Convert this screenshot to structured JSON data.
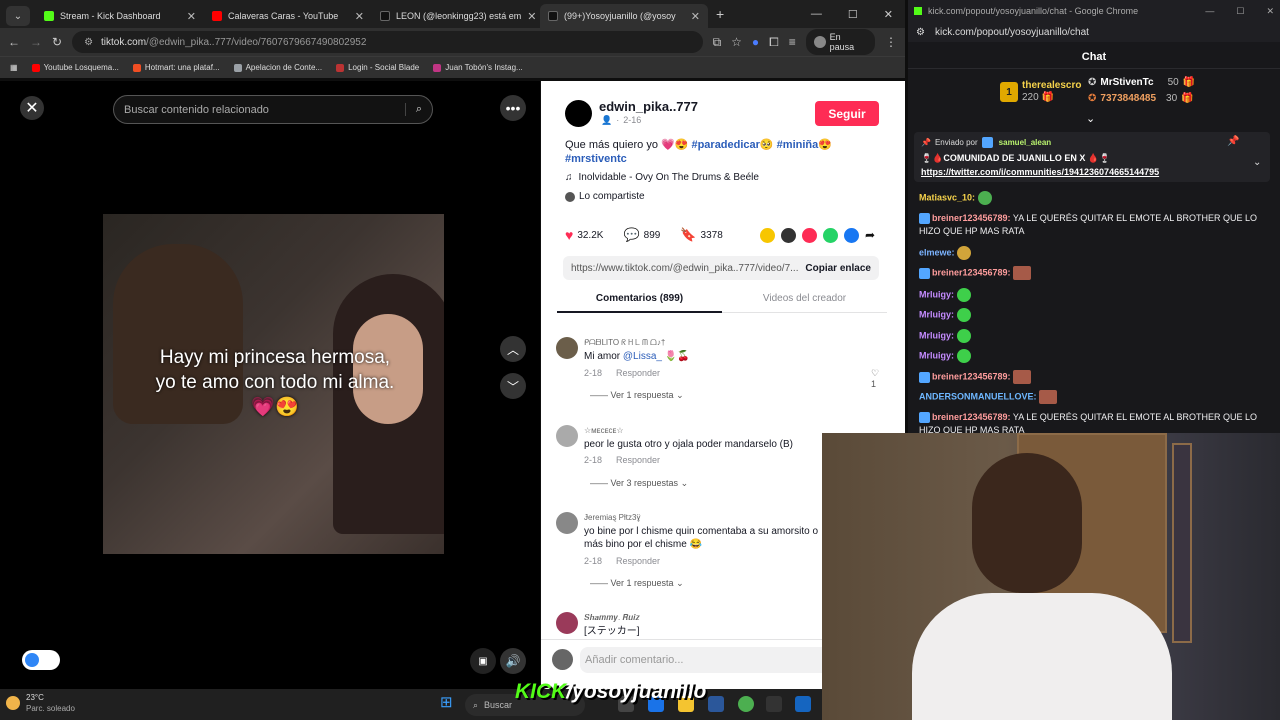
{
  "browser": {
    "tabs": [
      {
        "label": "Stream - Kick Dashboard",
        "color": "#53fc18"
      },
      {
        "label": "Calaveras Caras - YouTube",
        "color": "#ff0000"
      },
      {
        "label": "LEON (@leonkingg23) está em",
        "color": "#111111"
      },
      {
        "label": "(99+)Yosoyjuanillo (@yosoy",
        "color": "#111111",
        "active": true
      }
    ],
    "url_prefix": "tiktok.com",
    "url_rest": "/@edwin_pika..777/video/7607679667490802952",
    "paused_label": "En pausa",
    "bookmarks": [
      {
        "label": "Youtube Losquema...",
        "color": "#ff0000"
      },
      {
        "label": "Hotmart: una plataf...",
        "color": "#f04e23"
      },
      {
        "label": "Apelacion de Conte...",
        "color": "#9aa0a6"
      },
      {
        "label": "Login - Social Blade",
        "color": "#b33"
      },
      {
        "label": "Juan Tobón's Instag...",
        "color": "#c13584"
      }
    ]
  },
  "video": {
    "search_placeholder": "Buscar contenido relacionado",
    "caption": "Hayy mi princesa hermosa, yo te amo con todo mi alma.💗😍",
    "close_glyph": "✕",
    "more_glyph": "•••"
  },
  "detail": {
    "username": "edwin_pika..777",
    "follow_label": "Seguir",
    "date": "2-16",
    "desc_text": "Que más quiero yo 💗😍 ",
    "desc_tags": "#paradedicar🥺 #miniña😍 #mrstiventc",
    "music": "Inolvidable - Ovy On The Drums & Beéle",
    "shared": "Lo compartiste",
    "likes": "32.2K",
    "comments": "899",
    "saves": "3378",
    "link": "https://www.tiktok.com/@edwin_pika..777/video/7...",
    "copy_label": "Copiar enlace",
    "tab_comments": "Comentarios (899)",
    "tab_videos": "Videos del creador",
    "reply_label": "Responder",
    "comments_list": [
      {
        "name": "ᑭᗩᗷᒪITO ᖇ ᕼ ᒪ ᗰ ᗝ♪†",
        "text": "Mi amor ",
        "mention": "@Lissa_",
        "suffix": " 🌷🍒",
        "date": "2-18",
        "likes": "1",
        "replies": "Ver 1 respuesta"
      },
      {
        "name": "☆ᴍᴇᴄᴇᴄᴇ☆",
        "text": "peor le gusta otro y ojala poder mandarselo (B)",
        "date": "2-18",
        "replies": "Ver 3 respuestas"
      },
      {
        "name": "Ɉeremiaȿ Pƚtz3ɣ̈",
        "text": "yo bine por l chisme quin comentaba a su amorsito o más bino por el chisme 😂",
        "date": "2-18",
        "replies": "Ver 1 respuesta"
      },
      {
        "name": "𝑺𝒉𝒂𝒎𝒎𝒚. 𝑹𝒖𝒊𝒛",
        "text": "[ステッカー]",
        "date": "",
        "replies": ""
      }
    ],
    "add_comment_placeholder": "Añadir comentario..."
  },
  "chat": {
    "window_title": "kick.com/popout/yosoyjuanillo/chat - Google Chrome",
    "url": "kick.com/popout/yosoyjuanillo/chat",
    "header": "Chat",
    "top_rank_name": "therealescro",
    "top_rank_value": "220",
    "rank2_name": "MrStivenTc",
    "rank2_value": "50",
    "rank3_name": "7373848485",
    "rank3_value": "30",
    "pinned_by_label": "Enviado por",
    "pinned_user": "samuel_alean",
    "pinned_title": "🍷🩸COMUNIDAD DE JUANILLO EN X 🩸🍷",
    "pinned_link": "https://twitter.com/i/communities/1941236074665144795",
    "messages": [
      {
        "user": "Matiasvc_10:",
        "color": "#f5d24b",
        "text": ""
      },
      {
        "user": "breiner123456789:",
        "color": "#ff9d9d",
        "text": " YA LE QUERÉS QUITAR EL EMOTE AL BROTHER QUE LO HIZO QUE HP MAS RATA",
        "badge": true
      },
      {
        "user": "elmewe:",
        "color": "#7bb3ff",
        "text": ""
      },
      {
        "user": "breiner123456789:",
        "color": "#ff9d9d",
        "text": "",
        "badge": true
      },
      {
        "user": "Mrluigy:",
        "color": "#c58cff",
        "text": ""
      },
      {
        "user": "Mrluigy:",
        "color": "#c58cff",
        "text": ""
      },
      {
        "user": "Mrluigy:",
        "color": "#c58cff",
        "text": ""
      },
      {
        "user": "Mrluigy:",
        "color": "#c58cff",
        "text": ""
      },
      {
        "user": "breiner123456789:",
        "color": "#ff9d9d",
        "text": "",
        "badge": true
      },
      {
        "user": "ANDERSONMANUELLOVE:",
        "color": "#6eb7ff",
        "text": ""
      },
      {
        "user": "breiner123456789:",
        "color": "#ff9d9d",
        "text": " YA LE QUERÉS QUITAR EL EMOTE AL BROTHER QUE LO HIZO QUE HP MAS RATA",
        "badge": true
      }
    ]
  },
  "taskbar": {
    "temp": "23°C",
    "weather": "Parc. soleado",
    "search": "Buscar"
  },
  "overlay": {
    "kick": "KICK",
    "channel": "/yosoyjuanillo"
  }
}
